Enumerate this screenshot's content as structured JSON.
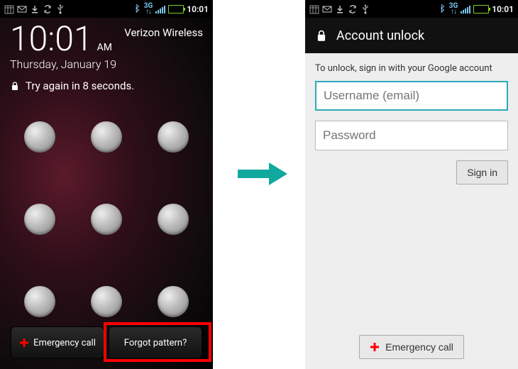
{
  "status": {
    "network": "3G",
    "clock": "10:01"
  },
  "left": {
    "carrier": "Verizon Wireless",
    "time": "10:01",
    "ampm": "AM",
    "date": "Thursday, January 19",
    "lock_msg": "Try again in 8 seconds.",
    "emergency_label": "Emergency call",
    "forgot_label": "Forgot pattern?"
  },
  "right": {
    "title": "Account unlock",
    "instruction": "To unlock, sign in with your Google account",
    "username_placeholder": "Username (email)",
    "password_placeholder": "Password",
    "signin_label": "Sign in",
    "emergency_label": "Emergency call"
  }
}
